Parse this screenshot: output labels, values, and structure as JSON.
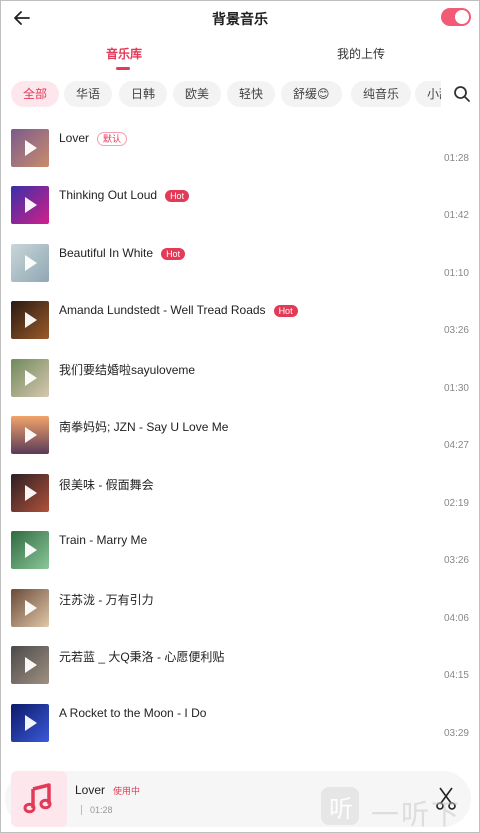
{
  "header": {
    "title": "背景音乐"
  },
  "tabs": [
    {
      "label": "音乐库",
      "active": true
    },
    {
      "label": "我的上传",
      "active": false
    }
  ],
  "categories": [
    "全部",
    "华语",
    "日韩",
    "欧美",
    "轻快",
    "舒缓😊",
    "纯音乐",
    "小甜"
  ],
  "songs": [
    {
      "title": "Lover",
      "badge": "默认",
      "duration": "01:28"
    },
    {
      "title": "Thinking Out Loud",
      "badge": "Hot",
      "duration": "01:42"
    },
    {
      "title": "Beautiful In White",
      "badge": "Hot",
      "duration": "01:10"
    },
    {
      "title": "Amanda Lundstedt - Well Tread Roads",
      "badge": "Hot",
      "duration": "03:26"
    },
    {
      "title": "我们要结婚啦sayuloveme",
      "badge": "",
      "duration": "01:30"
    },
    {
      "title": "南拳妈妈; JZN - Say U Love Me",
      "badge": "",
      "duration": "04:27"
    },
    {
      "title": "很美味 - 假面舞会",
      "badge": "",
      "duration": "02:19"
    },
    {
      "title": "Train - Marry Me",
      "badge": "",
      "duration": "03:26"
    },
    {
      "title": "汪苏泷 - 万有引力",
      "badge": "",
      "duration": "04:06"
    },
    {
      "title": "元若蓝 _ 大Q秉洛 - 心愿便利贴",
      "badge": "",
      "duration": "04:15"
    },
    {
      "title": "A Rocket to the Moon - I Do",
      "badge": "",
      "duration": "03:29"
    }
  ],
  "player": {
    "title": "Lover",
    "status": "使用中",
    "time": "01:28"
  },
  "watermark": "一听下载",
  "colors": {
    "accent": "#e23a57",
    "toggle": "#f25b76"
  }
}
